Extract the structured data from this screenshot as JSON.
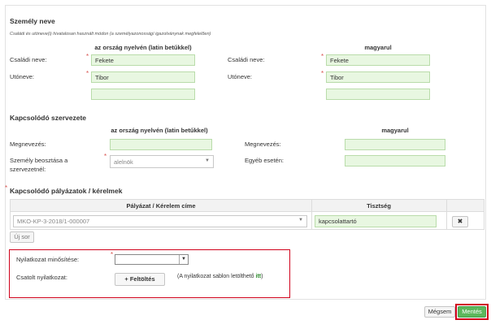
{
  "person": {
    "title": "Személy neve",
    "note": "Családi és utóneve(i) hivatalosan használt módon (a személyazonosságí igazolványnak megfelelően)",
    "col_local": "az ország nyelvén (latin betűkkel)",
    "col_hu": "magyarul",
    "family_label": "Családi neve:",
    "given_label": "Utóneve:",
    "family_local": "Fekete",
    "given_local": "Tibor",
    "extra_local": "",
    "family_hu_label": "Családi neve:",
    "given_hu_label": "Utóneve:",
    "family_hu": "Fekete",
    "given_hu": "Tibor",
    "extra_hu": ""
  },
  "org": {
    "title": "Kapcsolódó szervezete",
    "col_local": "az ország nyelvén (latin betűkkel)",
    "col_hu": "magyarul",
    "name_label": "Megnevezés:",
    "name_local": "",
    "role_label_1": "Személy beosztása a",
    "role_label_2": "szervezetnél:",
    "role_value": "alelnök",
    "name_hu_label": "Megnevezés:",
    "name_hu": "",
    "other_label": "Egyéb esetén:",
    "other_value": ""
  },
  "apps": {
    "title": "Kapcsolódó pályázatok / kérelmek",
    "col_title": "Pályázat / Kérelem címe",
    "col_role": "Tisztség",
    "row_app": "MKO-KP-3-2018/1-000007",
    "row_role": "kapcsolattartó",
    "new_row": "Új sor"
  },
  "declaration": {
    "type_label": "Nyilatkozat minősítése:",
    "type_value": "",
    "attached_label": "Csatolt nyilatkozat:",
    "upload_label": "Feltöltés",
    "hint_prefix": "(A nyilatkozat sablon letölthető ",
    "hint_link": "itt",
    "hint_suffix": ")"
  },
  "actions": {
    "cancel": "Mégsem",
    "save": "Mentés"
  },
  "required_mark": "*",
  "colors": {
    "input_bg": "#e8f7e1",
    "highlight": "#d0021b",
    "save_bg": "#5cb85c"
  }
}
